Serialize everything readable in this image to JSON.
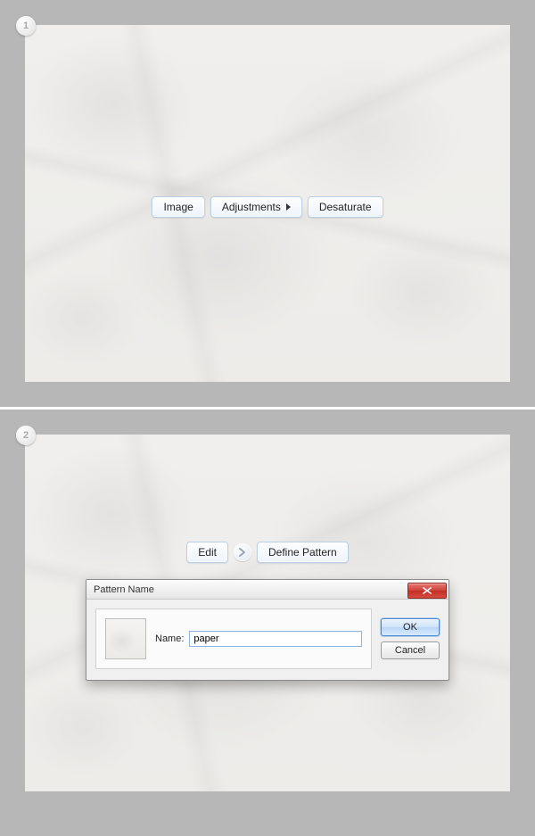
{
  "step1": {
    "badge": "1",
    "crumbs": {
      "image": "Image",
      "adjustments": "Adjustments",
      "desaturate": "Desaturate"
    }
  },
  "step2": {
    "badge": "2",
    "crumbs": {
      "edit": "Edit",
      "define_pattern": "Define Pattern"
    },
    "dialog": {
      "title": "Pattern Name",
      "name_label": "Name:",
      "name_value": "paper",
      "ok": "OK",
      "cancel": "Cancel"
    }
  }
}
